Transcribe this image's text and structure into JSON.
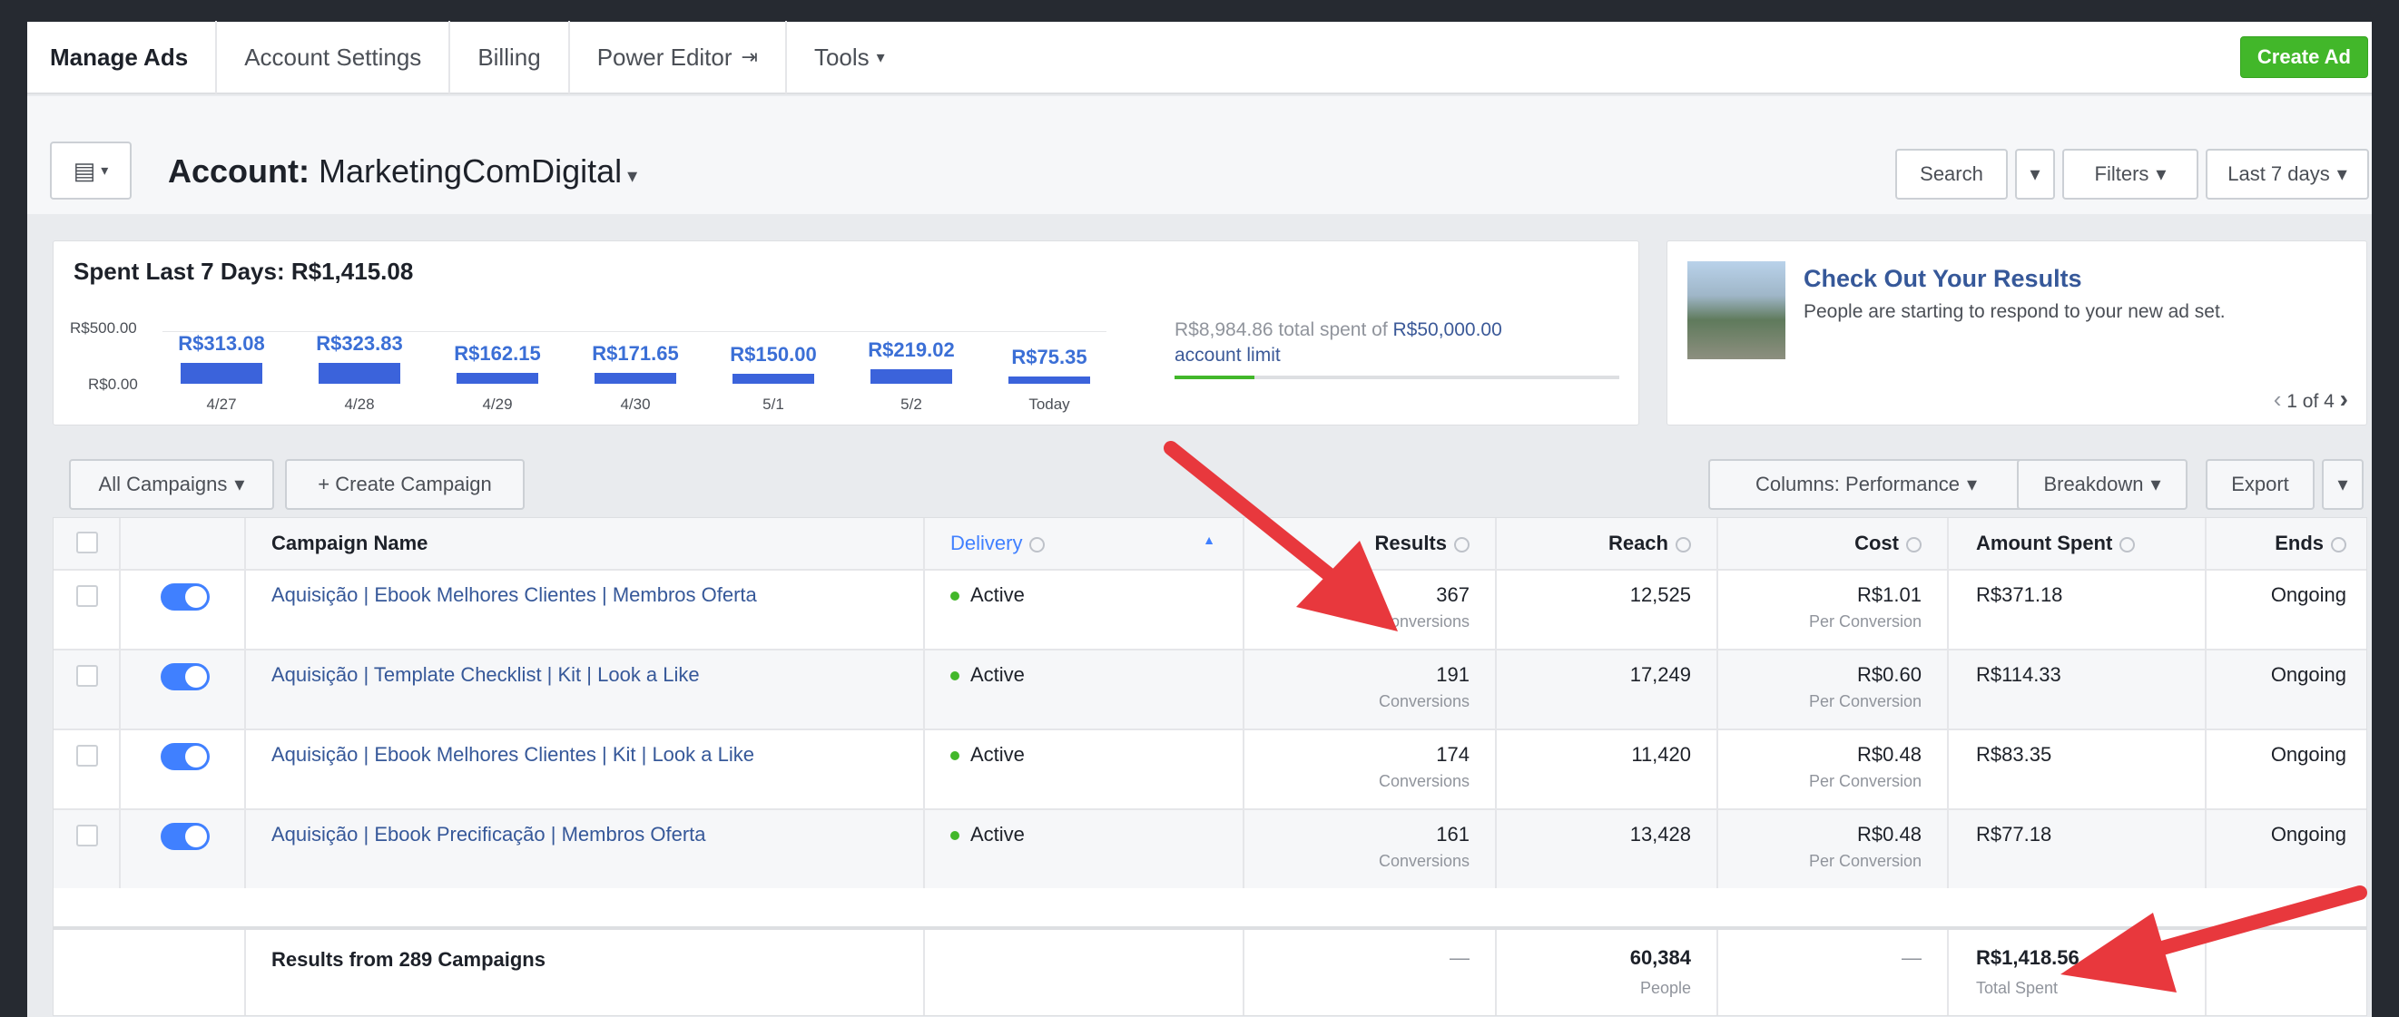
{
  "nav": {
    "tabs": [
      "Manage Ads",
      "Account Settings",
      "Billing",
      "Power Editor",
      "Tools"
    ],
    "power_editor_icon": "external-icon",
    "tools_caret": "▾",
    "create_ad": "Create Ad"
  },
  "account": {
    "prefix": "Account:",
    "name": "MarketingComDigital",
    "search": "Search",
    "filters": "Filters",
    "date_range": "Last 7 days"
  },
  "spend": {
    "title": "Spent Last 7 Days: R$1,415.08",
    "ymax_label": "R$500.00",
    "ymin_label": "R$0.00",
    "limit_text_1": "R$8,984.86 total spent of ",
    "limit_text_2": "R$50,000.00",
    "limit_text_3": "account limit",
    "limit_fraction": 0.18
  },
  "chart_data": {
    "type": "bar",
    "categories": [
      "4/27",
      "4/28",
      "4/29",
      "4/30",
      "5/1",
      "5/2",
      "Today"
    ],
    "values": [
      313.08,
      323.83,
      162.15,
      171.65,
      150.0,
      219.02,
      75.35
    ],
    "labels": [
      "R$313.08",
      "R$323.83",
      "R$162.15",
      "R$171.65",
      "R$150.00",
      "R$219.02",
      "R$75.35"
    ],
    "title": "Spent Last 7 Days: R$1,415.08",
    "ylim": [
      0,
      500
    ],
    "ytick_labels": [
      "R$500.00",
      "R$0.00"
    ],
    "color": "#3b63db"
  },
  "checkout": {
    "title": "Check Out Your Results",
    "subtitle": "People are starting to respond to your new ad set.",
    "pager": "1 of 4"
  },
  "toolbar": {
    "all_campaigns": "All Campaigns",
    "create_campaign": "+ Create Campaign",
    "columns": "Columns: Performance",
    "breakdown": "Breakdown",
    "export": "Export"
  },
  "table": {
    "headers": {
      "name": "Campaign Name",
      "delivery": "Delivery",
      "results": "Results",
      "reach": "Reach",
      "cost": "Cost",
      "amount": "Amount Spent",
      "ends": "Ends"
    },
    "rows": [
      {
        "name": "Aquisição | Ebook Melhores Clientes | Membros Oferta",
        "delivery": "Active",
        "results": "367",
        "results_sub": "Conversions",
        "reach": "12,525",
        "cost": "R$1.01",
        "cost_sub": "Per Conversion",
        "amount": "R$371.18",
        "ends": "Ongoing"
      },
      {
        "name": "Aquisição | Template Checklist | Kit | Look a Like",
        "delivery": "Active",
        "results": "191",
        "results_sub": "Conversions",
        "reach": "17,249",
        "cost": "R$0.60",
        "cost_sub": "Per Conversion",
        "amount": "R$114.33",
        "ends": "Ongoing"
      },
      {
        "name": "Aquisição | Ebook Melhores Clientes | Kit | Look a Like",
        "delivery": "Active",
        "results": "174",
        "results_sub": "Conversions",
        "reach": "11,420",
        "cost": "R$0.48",
        "cost_sub": "Per Conversion",
        "amount": "R$83.35",
        "ends": "Ongoing"
      },
      {
        "name": "Aquisição | Ebook Precificação | Membros Oferta",
        "delivery": "Active",
        "results": "161",
        "results_sub": "Conversions",
        "reach": "13,428",
        "cost": "R$0.48",
        "cost_sub": "Per Conversion",
        "amount": "R$77.18",
        "ends": "Ongoing"
      }
    ],
    "footer": {
      "label": "Results from 289 Campaigns",
      "results": "—",
      "reach": "60,384",
      "reach_sub": "People",
      "cost": "—",
      "amount": "R$1,418.56",
      "amount_sub": "Total Spent"
    }
  },
  "colors": {
    "accent": "#365899",
    "bar": "#3b63db",
    "green": "#42b72a",
    "arrow": "#e8383d"
  }
}
